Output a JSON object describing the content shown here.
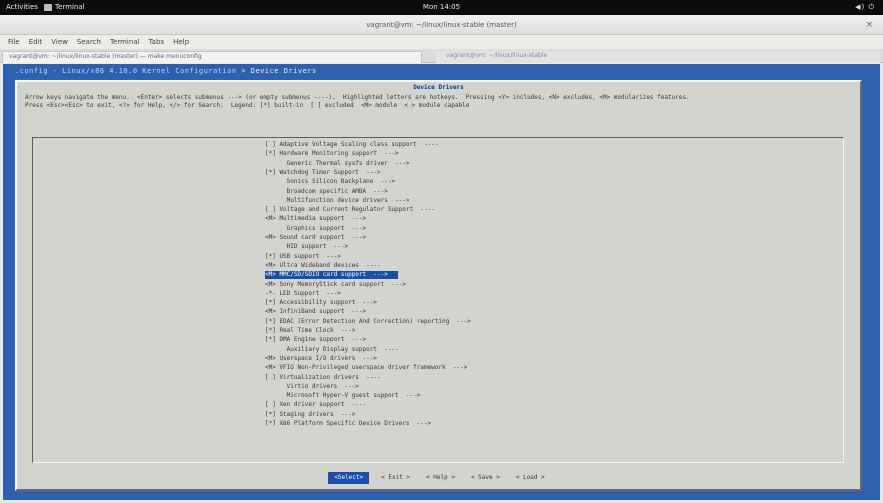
{
  "panel": {
    "activities": "Activities",
    "app": "Terminal",
    "clock": "Mon 14:05",
    "status": "◀) ⏻"
  },
  "window": {
    "title": "vagrant@vm: ~/linux/linux-stable (master)",
    "close": "×",
    "menu": [
      "File",
      "Edit",
      "View",
      "Search",
      "Terminal",
      "Tabs",
      "Help"
    ],
    "tabs": [
      "vagrant@vm: ~/linux/linux-stable (master) — make menuconfig",
      "vagrant@vm: ~/linux/linux-stable"
    ]
  },
  "term": {
    "topline_a": ".config - Linux/x86 4.10.0 Kernel Configuration",
    "topline_b": "> Device Drivers",
    "frame_title": "Device Drivers",
    "help_lines": [
      "Arrow keys navigate the menu.  <Enter> selects submenus ---> (or empty submenus ----).  Highlighted letters are hotkeys.  Pressing <Y> includes, <N> excludes, <M> modularizes features.",
      "Press <Esc><Esc> to exit, <?> for Help, </> for Search.  Legend: [*] built-in  [ ] excluded  <M> module  < > module capable"
    ],
    "items": [
      "[ ] Adaptive Voltage Scaling class support  ----",
      "[*] Hardware Monitoring support  --->",
      "      Generic Thermal sysfs driver  --->",
      "[*] Watchdog Timer Support  --->",
      "      Sonics Silicon Backplane  --->",
      "      Broadcom specific AMBA  --->",
      "      Multifunction device drivers  --->",
      "[ ] Voltage and Current Regulator Support  ----",
      "<M> Multimedia support  --->",
      "      Graphics support  --->",
      "<M> Sound card support  --->",
      "      HID support  --->",
      "[*] USB support  --->",
      "<M> Ultra Wideband devices  ----",
      "<M> MMC/SD/SDIO card support  --->",
      "<M> Sony MemoryStick card support  --->",
      "-*- LED Support  --->",
      "[*] Accessibility support  --->",
      "<M> InfiniBand support  --->",
      "[*] EDAC (Error Detection And Correction) reporting  --->",
      "[*] Real Time Clock  --->",
      "[*] DMA Engine support  --->",
      "      Auxiliary Display support  ----",
      "<M> Userspace I/O drivers  --->",
      "<M> VFIO Non-Privileged userspace driver framework  --->",
      "[ ] Virtualization drivers  ----",
      "      Virtio drivers  --->",
      "      Microsoft Hyper-V guest support  --->",
      "[ ] Xen driver support  ----",
      "[*] Staging drivers  --->",
      "[*] X86 Platform Specific Device Drivers  --->"
    ],
    "selected_index": 14,
    "buttons": [
      "<Select>",
      "< Exit >",
      "< Help >",
      "< Save >",
      "< Load >"
    ],
    "active_button": 0
  },
  "colors": {
    "terminal_bg": "#2f60b0",
    "dialog_bg": "#d3d3d0",
    "highlight": "#1d4ea6"
  }
}
